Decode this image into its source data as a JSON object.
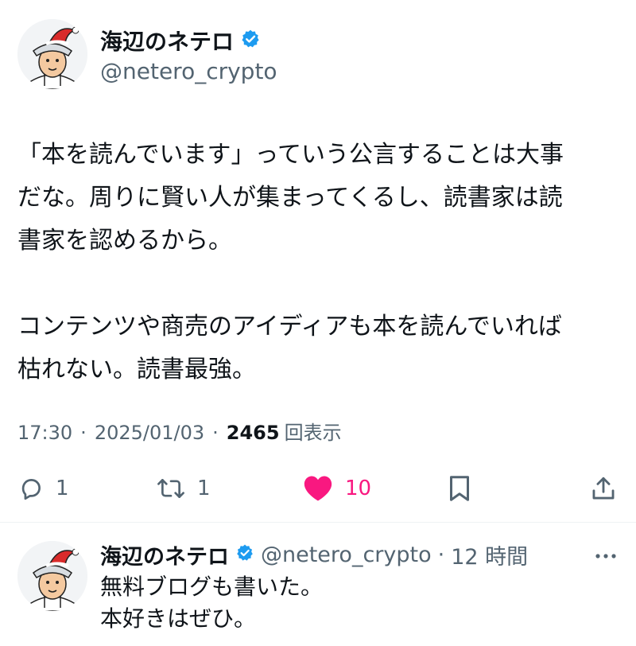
{
  "tweet": {
    "author": {
      "name": "海辺のネテロ",
      "handle": "@netero_crypto",
      "verified": true
    },
    "text": "「本を読んでいます」っていう公言することは大事\nだな。周りに賢い人が集まってくるし、読書家は読\n書家を認めるから。\n\nコンテンツや商売のアイディアも本を読んでいれば\n枯れない。読書最強。",
    "time": "17:30",
    "separator": "·",
    "date": "2025/01/03",
    "views": "2465",
    "views_label": "回表示",
    "actions": {
      "reply": {
        "icon": "reply-icon",
        "count": "1"
      },
      "retweet": {
        "icon": "retweet-icon",
        "count": "1"
      },
      "like": {
        "icon": "heart-icon",
        "count": "10",
        "active": true
      },
      "bookmark": {
        "icon": "bookmark-icon"
      },
      "share": {
        "icon": "share-icon"
      }
    }
  },
  "reply": {
    "author": {
      "name": "海辺のネテロ",
      "handle": "@netero_crypto",
      "verified": true
    },
    "separator": "·",
    "relative_time": "12 時間",
    "text": "無料ブログも書いた。\n本好きはぜひ。",
    "more_icon": "more-icon"
  },
  "colors": {
    "text": "#0f1419",
    "secondary": "#536471",
    "verified": "#1d9bf0",
    "like": "#f91880",
    "divider": "#eff3f4"
  }
}
